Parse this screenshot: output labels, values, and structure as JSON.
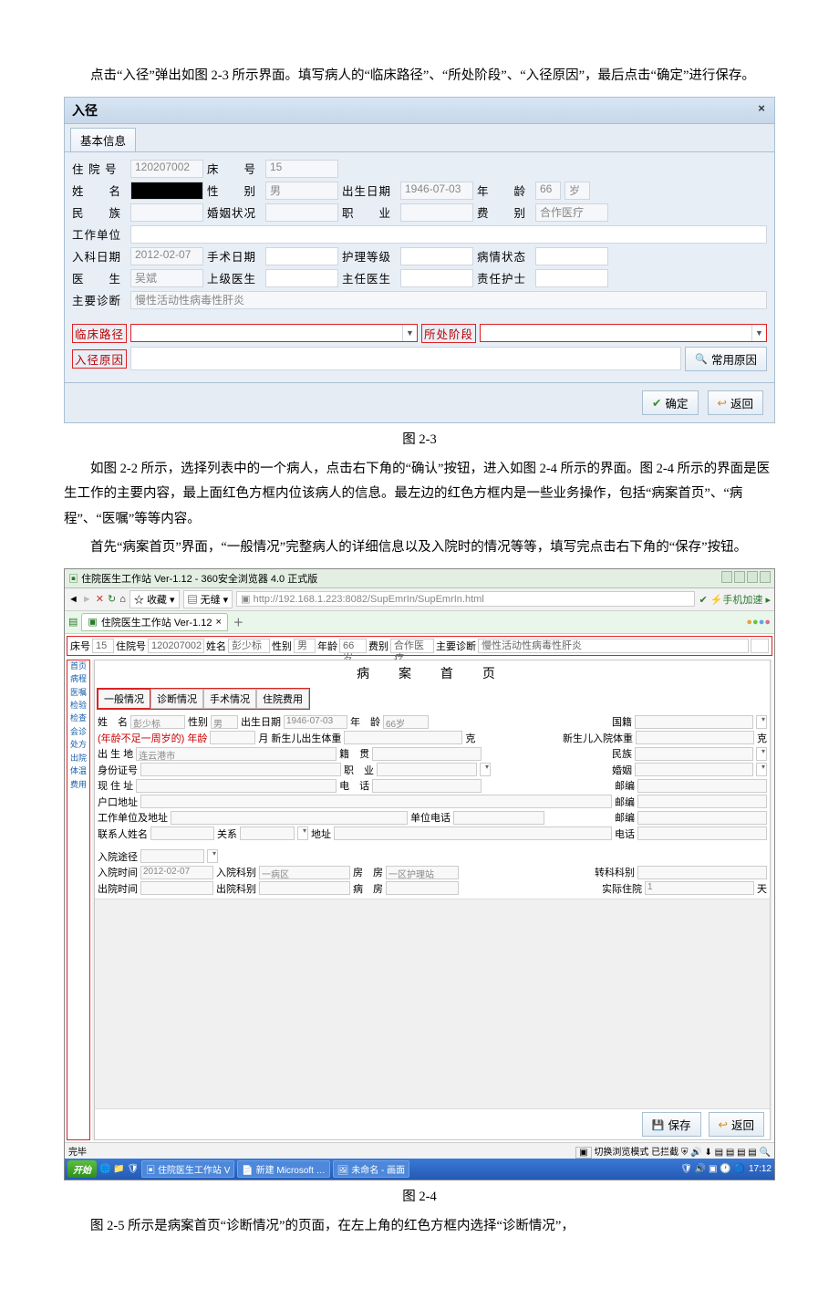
{
  "text": {
    "p1": "点击“入径”弹出如图 2-3 所示界面。填写病人的“临床路径”、“所处阶段”、“入径原因”，最后点击“确定”进行保存。",
    "cap23": "图 2-3",
    "p2": "如图 2-2 所示，选择列表中的一个病人，点击右下角的“确认”按钮，进入如图 2-4 所示的界面。图 2-4 所示的界面是医生工作的主要内容，最上面红色方框内位该病人的信息。最左边的红色方框内是一些业务操作，包括“病案首页”、“病程”、“医嘱”等等内容。",
    "p3": "首先“病案首页”界面，“一般情况”完整病人的详细信息以及入院时的情况等等，填写完点击右下角的“保存”按钮。",
    "cap24": "图 2-4",
    "p4": "图 2-5 所示是病案首页“诊断情况”的页面，在左上角的红色方框内选择“诊断情况”，"
  },
  "dlg": {
    "title": "入径",
    "tab_basic": "基本信息",
    "labels": {
      "hospital_no": "住 院 号",
      "bed_no": "床　　号",
      "name": "姓　　名",
      "sex": "性　　别",
      "birth": "出生日期",
      "age": "年　　龄",
      "age_unit": "岁",
      "nation": "民　　族",
      "marriage": "婚姻状况",
      "job": "职　　业",
      "fee": "费　　别",
      "work_unit": "工作单位",
      "in_date": "入科日期",
      "op_date": "手术日期",
      "nurse_level": "护理等级",
      "illness": "病情状态",
      "doctor": "医　　生",
      "sup_doctor": "上级医生",
      "chief_doctor": "主任医生",
      "nurse": "责任护士",
      "main_dx": "主要诊断",
      "path": "临床路径",
      "stage": "所处阶段",
      "reason": "入径原因"
    },
    "values": {
      "hospital_no": "120207002",
      "bed_no": "15",
      "sex": "男",
      "birth": "1946-07-03",
      "age": "66",
      "fee": "合作医疗",
      "in_date": "2012-02-07",
      "doctor": "吴斌",
      "main_dx": "慢性活动性病毒性肝炎"
    },
    "buttons": {
      "common_reason": "常用原因",
      "ok": "确定",
      "back": "返回"
    }
  },
  "fig24": {
    "browser_title": "住院医生工作站 Ver-1.12 - 360安全浏览器 4.0 正式版",
    "url": "http://192.168.1.223:8082/SupEmrIn/SupEmrIn.html",
    "nav_items": [
      "收藏",
      "无缝"
    ],
    "tab_title": "住院医生工作站 Ver-1.12",
    "right_link": "手机加速",
    "info_strip": {
      "bed": "床号",
      "bed_v": "15",
      "hosp": "住院号",
      "hosp_v": "120207002",
      "name": "姓名",
      "name_v": "彭少标",
      "sex": "性别",
      "sex_v": "男",
      "age": "年龄",
      "age_v": "66岁",
      "fee": "费别",
      "fee_v": "合作医疗",
      "dx": "主要诊断",
      "dx_v": "慢性活动性病毒性肝炎"
    },
    "sidebar": [
      "首页",
      "病程",
      "医嘱",
      "检验",
      "检查",
      "会诊",
      "处方",
      "出院",
      "体温",
      "费用"
    ],
    "big_title": "病 案 首 页",
    "subtabs": [
      "一般情况",
      "诊断情况",
      "手术情况",
      "住院费用"
    ],
    "form": {
      "name": "姓　名",
      "name_v": "彭少标",
      "sex": "性别",
      "sex_v": "男",
      "birth": "出生日期",
      "birth_v": "1946-07-03",
      "age": "年　龄",
      "age_v": "66岁",
      "nationality": "国籍",
      "age_note": "(年龄不足一周岁的) 年龄",
      "age_note_unit": "月",
      "nb_weight": "新生儿出生体重",
      "nb_weight_unit": "克",
      "nb_in_weight": "新生儿入院体重",
      "nb_in_weight_unit": "克",
      "birth_place": "出 生 地",
      "birth_place_v": "连云港市",
      "native": "籍　贯",
      "nation": "民族",
      "id_no": "身份证号",
      "job": "职　业",
      "marriage": "婚姻",
      "addr": "现 住 址",
      "phone": "电　话",
      "zip": "邮编",
      "hukou": "户口地址",
      "zip2": "邮编",
      "work_addr": "工作单位及地址",
      "work_phone": "单位电话",
      "zip3": "邮编",
      "contact": "联系人姓名",
      "relation": "关系",
      "contact_addr": "地址",
      "contact_phone": "电话",
      "in_way": "入院途径",
      "in_time": "入院时间",
      "in_time_v": "2012-02-07",
      "in_dept": "入院科别",
      "in_dept_v": "一病区",
      "room": "房　房",
      "room_v": "一区护理站",
      "trans_dept": "转科科别",
      "out_time": "出院时间",
      "out_dept": "出院科别",
      "ward": "病　房",
      "actual_days": "实际住院",
      "actual_days_v": "1",
      "days_unit": "天"
    },
    "buttons": {
      "save": "保存",
      "back": "返回"
    },
    "statusbar_left": "完毕",
    "statusbar_right": "切换浏览模式 已拦截",
    "taskbar": {
      "start": "开始",
      "items": [
        "住院医生工作站 V",
        "新建 Microsoft …",
        "未命名 - 画面"
      ],
      "time": "17:12"
    }
  }
}
